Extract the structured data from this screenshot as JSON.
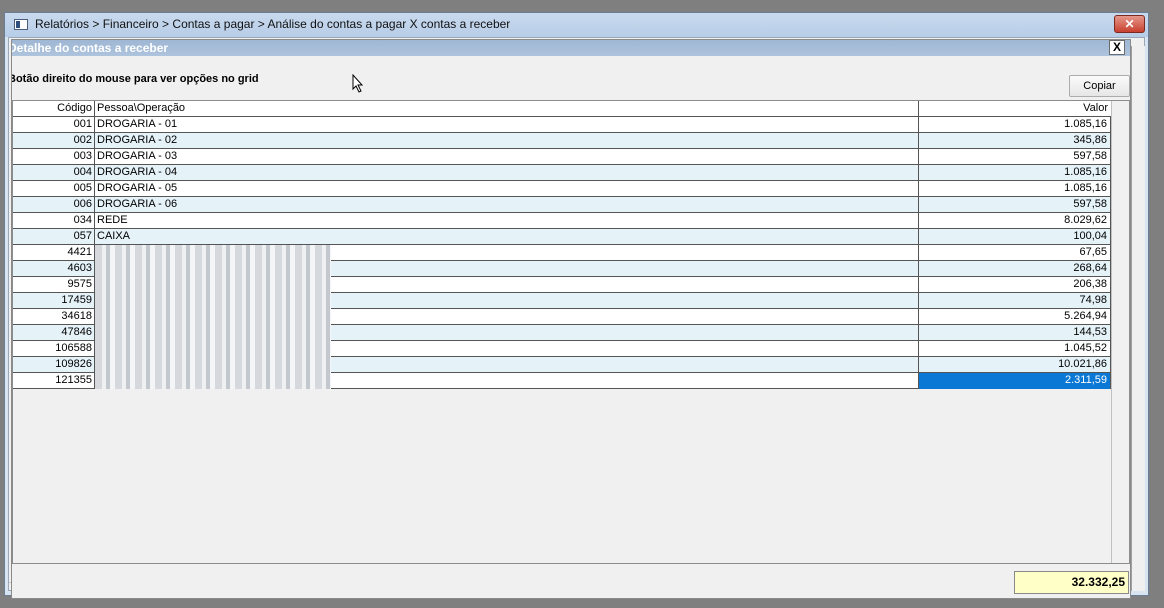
{
  "window": {
    "title": "Relatórios > Financeiro > Contas a pagar > Análise do contas a pagar X contas a receber",
    "close_glyph": "✕"
  },
  "dialog": {
    "title": "Detalhe do contas a receber",
    "close_glyph": "X",
    "hint": "Botão direito do mouse para ver opções no grid",
    "copy_label": "Copiar"
  },
  "grid": {
    "columns": {
      "code": "Código",
      "name": "Pessoa\\Operação",
      "value": "Valor"
    },
    "rows": [
      {
        "code": "001",
        "name": "DROGARIA - 01",
        "value": "1.085,16",
        "redacted": false
      },
      {
        "code": "002",
        "name": "DROGARIA - 02",
        "value": "345,86",
        "redacted": false
      },
      {
        "code": "003",
        "name": "DROGARIA - 03",
        "value": "597,58",
        "redacted": false
      },
      {
        "code": "004",
        "name": "DROGARIA - 04",
        "value": "1.085,16",
        "redacted": false
      },
      {
        "code": "005",
        "name": "DROGARIA - 05",
        "value": "1.085,16",
        "redacted": false
      },
      {
        "code": "006",
        "name": "DROGARIA - 06",
        "value": "597,58",
        "redacted": false
      },
      {
        "code": "034",
        "name": "REDE",
        "value": "8.029,62",
        "redacted": false
      },
      {
        "code": "057",
        "name": "CAIXA",
        "value": "100,04",
        "redacted": false
      },
      {
        "code": "4421",
        "name": "",
        "value": "67,65",
        "redacted": true
      },
      {
        "code": "4603",
        "name": "",
        "value": "268,64",
        "redacted": true
      },
      {
        "code": "9575",
        "name": "",
        "value": "206,38",
        "redacted": true
      },
      {
        "code": "17459",
        "name": "",
        "value": "74,98",
        "redacted": true
      },
      {
        "code": "34618",
        "name": "",
        "value": "5.264,94",
        "redacted": true
      },
      {
        "code": "47846",
        "name": "",
        "value": "144,53",
        "redacted": true
      },
      {
        "code": "106588",
        "name": "",
        "value": "1.045,52",
        "redacted": true
      },
      {
        "code": "109826",
        "name": "",
        "value": "10.021,86",
        "redacted": true
      },
      {
        "code": "121355",
        "name": "",
        "value": "2.311,59",
        "redacted": true,
        "selected": true
      }
    ],
    "total": "32.332,25"
  },
  "colors": {
    "selected_cell": "#0a78d4",
    "row_alt": "#e5f2f8",
    "total_bg": "#ffffc8",
    "dialog_title_bg": "#aec3dc"
  }
}
